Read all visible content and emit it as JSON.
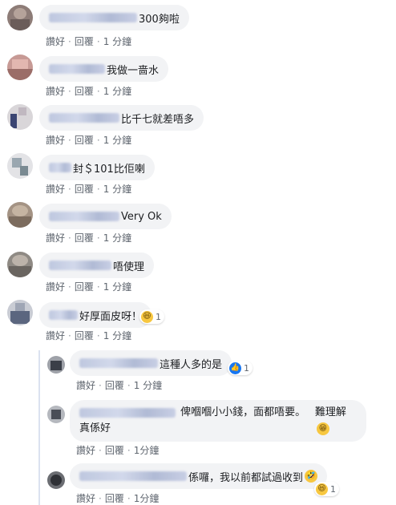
{
  "actions": {
    "like": "讚好",
    "reply": "回覆",
    "sep": "·"
  },
  "comments": [
    {
      "text": "300夠啦",
      "time": "1 分鐘"
    },
    {
      "text": "我做一啬水",
      "time": "1 分鐘"
    },
    {
      "text": "比千七就差唔多",
      "time": "1 分鐘"
    },
    {
      "text": "封＄101比佢喇",
      "time": "1 分鐘"
    },
    {
      "text": "Very Ok",
      "time": "1 分鐘"
    },
    {
      "text": "唔使理",
      "time": "1 分鐘"
    },
    {
      "text": "好厚面皮呀！",
      "time": "1 分鐘",
      "reaction_count": "1",
      "reaction_icon": "haha-icon"
    }
  ],
  "replies": [
    {
      "text": "這種人多的是",
      "time": "1 分鐘",
      "reaction_count": "1",
      "reaction_icon": "like-icon"
    },
    {
      "text_line1": "俾嗰嗰小小錢，面都唔要。真係好",
      "text_line2": "難理解",
      "emoji": "grinning-icon",
      "time": "1分鐘"
    },
    {
      "text": "係囉，我以前都試過收到",
      "emoji": "rofl-icon",
      "time": "1分鐘",
      "reaction_count": "1",
      "reaction_icon": "haha-icon"
    }
  ],
  "colors": {
    "bubble": "#f2f3f5",
    "action_text": "#606770",
    "like_blue": "#1877f2",
    "haha_yellow": "#f7c740"
  }
}
